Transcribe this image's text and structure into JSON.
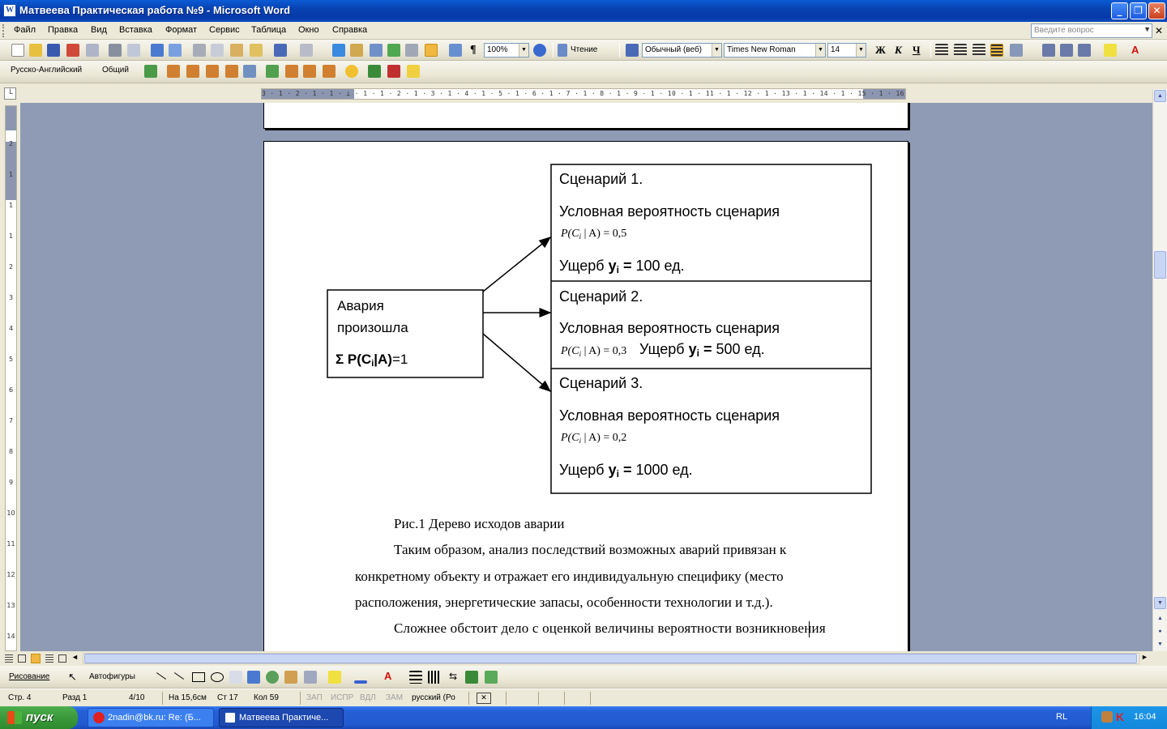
{
  "window": {
    "title": "Матвеева Практическая работа №9 - Microsoft Word"
  },
  "menu": [
    "Файл",
    "Правка",
    "Вид",
    "Вставка",
    "Формат",
    "Сервис",
    "Таблица",
    "Окно",
    "Справка"
  ],
  "ask_placeholder": "Введите вопрос",
  "toolbar": {
    "zoom": "100%",
    "reading": "Чтение",
    "style": "Обычный (веб)",
    "font": "Times New Roman",
    "size": "14",
    "bold": "Ж",
    "italic": "К",
    "underline": "Ч"
  },
  "toolbar2": {
    "dictionary": "Русско-Английский",
    "general": "Общий"
  },
  "ruler": {
    "h_numbers": "3 · 1 · 2 · 1 · 1 · ⊥ · 1 · 1 · 2 · 1 · 3 · 1 · 4 · 1 · 5 · 1 · 6 · 1 · 7 · 1 · 8 · 1 · 9 · 1 · 10 · 1 · 11 · 1 · 12 · 1 · 13 · 1 · 14 · 1 · 15 · 1 · 16 · △ · 17 · 1",
    "v_numbers": [
      "2",
      "1",
      "1",
      "1",
      "2",
      "3",
      "4",
      "5",
      "6",
      "7",
      "8",
      "9",
      "10",
      "11",
      "12",
      "13",
      "14"
    ]
  },
  "diagram": {
    "root": {
      "line1": "Авария",
      "line2": "произошла",
      "formula": "Σ P(C",
      "formula_sub": "i",
      "formula_end": "|A)",
      "formula_eq": "=1"
    },
    "scenarios": [
      {
        "title": "Сценарий 1.",
        "label": "Условная вероятность сценария",
        "prob_pre": "P(C",
        "prob_sub": "i",
        "prob_post": " | A) = 0,5",
        "damage_pre": "Ущерб ",
        "damage_y": "y",
        "damage_sub": "i",
        "damage_eq": " = ",
        "damage_val": "100 ед."
      },
      {
        "title": "Сценарий 2.",
        "label": "Условная вероятность сценария",
        "prob_pre": "P(C",
        "prob_sub": "i",
        "prob_post": " | A) = 0,3",
        "damage_pre": "Ущерб ",
        "damage_y": "y",
        "damage_sub": "i",
        "damage_eq": " = ",
        "damage_val": "500 ед."
      },
      {
        "title": "Сценарий 3.",
        "label": "Условная вероятность сценария",
        "prob_pre": "P(C",
        "prob_sub": "i",
        "prob_post": " | A) = 0,2",
        "damage_pre": "Ущерб ",
        "damage_y": "y",
        "damage_sub": "i",
        "damage_eq": " = ",
        "damage_val": "1000 ед."
      }
    ]
  },
  "document": {
    "caption": "Рис.1 Дерево исходов аварии",
    "lines": [
      "Таким образом, анализ последствий возможных аварий привязан к",
      "конкретному объекту и отражает его индивидуальную специфику (место",
      "расположения, энергетические запасы, особенности технологии и т.д.).",
      "Сложнее обстоит дело с оценкой величины вероятности возникновения"
    ]
  },
  "drawing": {
    "draw": "Рисование",
    "autoshapes": "Автофигуры"
  },
  "status": {
    "page": "Стр. 4",
    "section": "Разд 1",
    "pages": "4/10",
    "at": "На 15,6см",
    "line": "Ст 17",
    "col": "Кол 59",
    "rec": "ЗАП",
    "trk": "ИСПР",
    "ext": "ВДЛ",
    "ovr": "ЗАМ",
    "lang": "русский (Ро"
  },
  "taskbar": {
    "start": "пуск",
    "tasks": [
      "2nadin@bk.ru: Re: (Б...",
      "Матвеева Практиче..."
    ],
    "lang": "RL",
    "time": "16:04"
  }
}
